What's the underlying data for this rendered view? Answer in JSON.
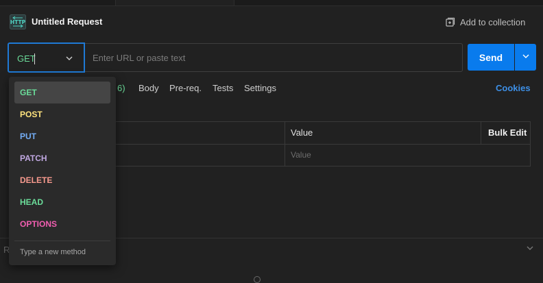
{
  "request": {
    "title": "Untitled Request",
    "icon": "http-request-icon",
    "add_to_collection": "Add to collection"
  },
  "url_bar": {
    "method": "GET",
    "url_value": "",
    "url_placeholder": "Enter URL or paste text",
    "send_label": "Send"
  },
  "tabs": {
    "params_count": "6)",
    "items": [
      "Body",
      "Pre-req.",
      "Tests",
      "Settings"
    ],
    "cookies": "Cookies"
  },
  "params_table": {
    "header_value": "Value",
    "bulk_edit": "Bulk Edit",
    "value_placeholder": "Value"
  },
  "response": {
    "letter": "R"
  },
  "method_dropdown": {
    "items": [
      {
        "label": "GET",
        "color": "#6bdd9a",
        "selected": true
      },
      {
        "label": "POST",
        "color": "#ffe47e",
        "selected": false
      },
      {
        "label": "PUT",
        "color": "#74aef6",
        "selected": false
      },
      {
        "label": "PATCH",
        "color": "#c0a8e1",
        "selected": false
      },
      {
        "label": "DELETE",
        "color": "#f79a8e",
        "selected": false
      },
      {
        "label": "HEAD",
        "color": "#6bdd9a",
        "selected": false
      },
      {
        "label": "OPTIONS",
        "color": "#f15eb0",
        "selected": false
      }
    ],
    "custom_hint": "Type a new method"
  },
  "colors": {
    "accent": "#097bed",
    "focus_border": "#1f7ad6",
    "link": "#3d8fe6",
    "background": "#212121"
  }
}
